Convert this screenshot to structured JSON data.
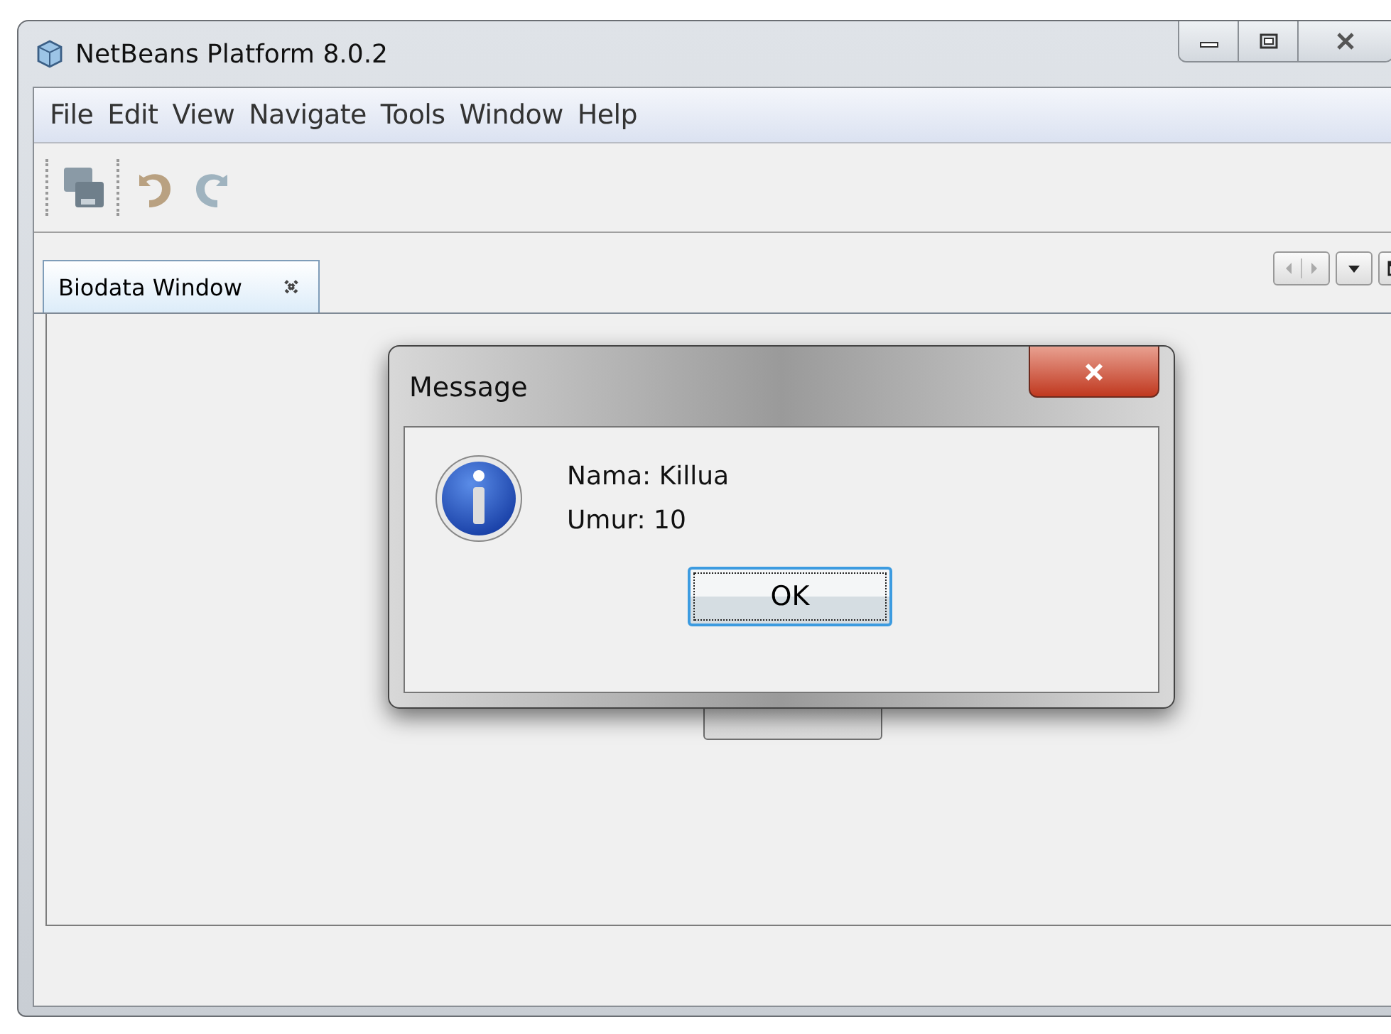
{
  "window": {
    "title": "NetBeans Platform 8.0.2"
  },
  "menu": [
    "File",
    "Edit",
    "View",
    "Navigate",
    "Tools",
    "Window",
    "Help"
  ],
  "tabs": [
    {
      "label": "Biodata Window",
      "selected": true
    }
  ],
  "dialog": {
    "title": "Message",
    "lines": [
      "Nama: Killua",
      "Umur: 10"
    ],
    "button": "OK"
  }
}
